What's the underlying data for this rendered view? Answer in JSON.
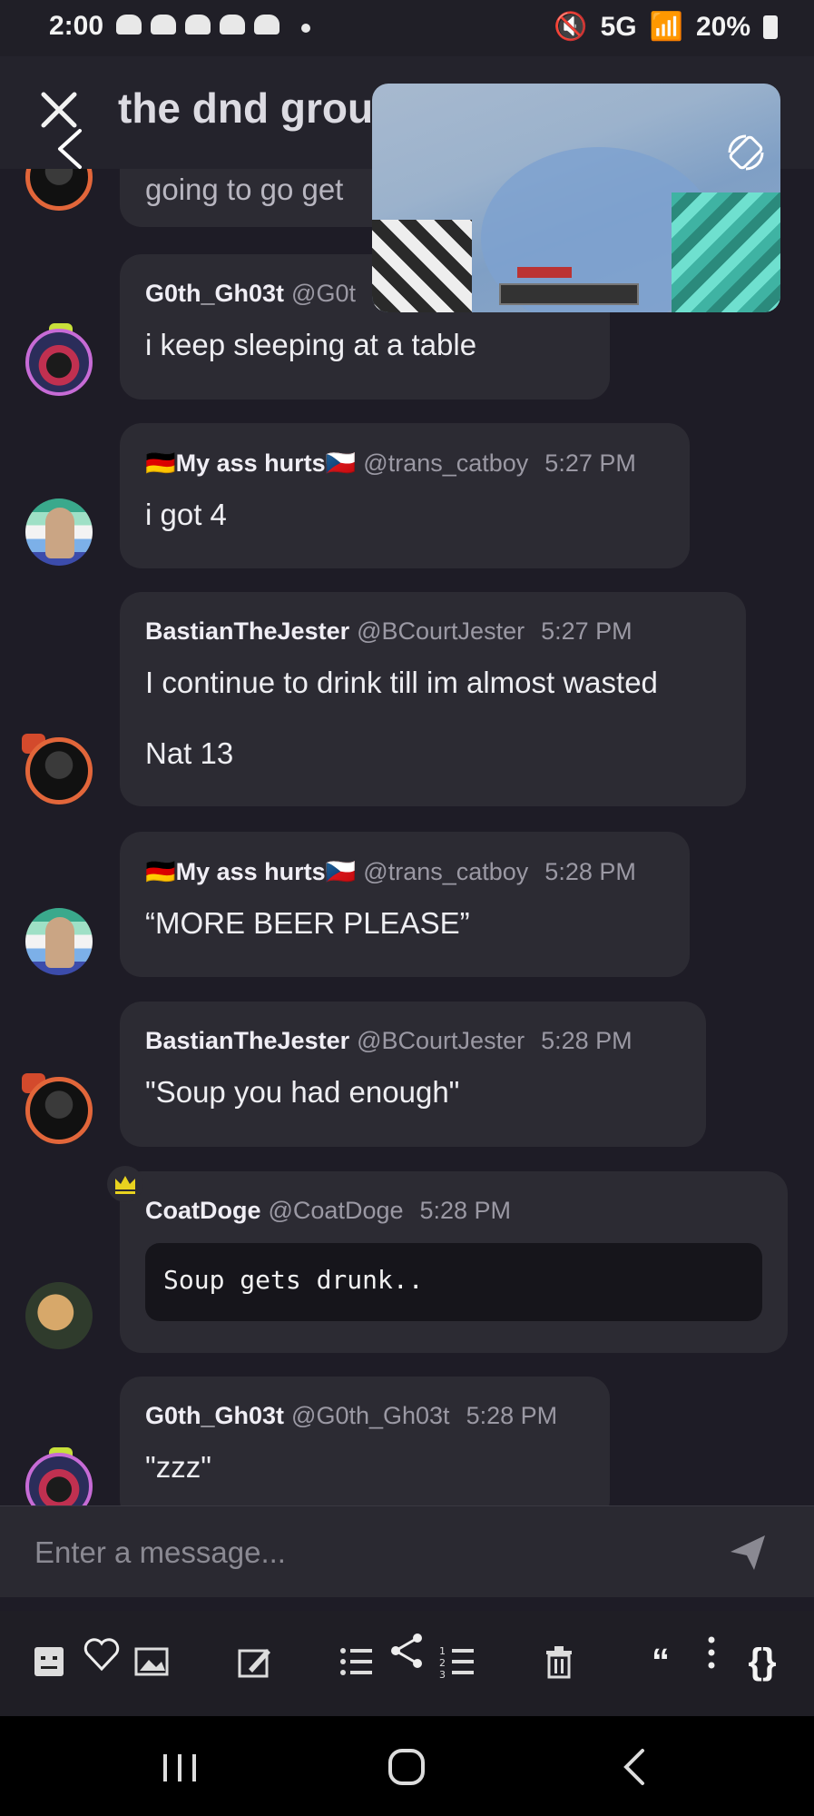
{
  "status_bar": {
    "time": "2:00",
    "right_text": "5G",
    "battery": "20%"
  },
  "header": {
    "title": "the dnd group"
  },
  "composer": {
    "placeholder": "Enter a message..."
  },
  "messages": [
    {
      "name": "",
      "handle": "",
      "time": "",
      "lines": [
        "going to go get"
      ]
    },
    {
      "name": "G0th_Gh03t",
      "handle": "@G0t",
      "time": "",
      "lines": [
        "i keep sleeping at a table"
      ]
    },
    {
      "name": "🇩🇪My ass hurts🇨🇿",
      "handle": "@trans_catboy",
      "time": "5:27 PM",
      "lines": [
        "i got 4"
      ]
    },
    {
      "name": "BastianTheJester",
      "handle": "@BCourtJester",
      "time": "5:27 PM",
      "lines": [
        "I continue to drink till im almost wasted",
        "Nat 13"
      ]
    },
    {
      "name": "🇩🇪My ass hurts🇨🇿",
      "handle": "@trans_catboy",
      "time": "5:28 PM",
      "lines": [
        "“MORE BEER PLEASE”"
      ]
    },
    {
      "name": "BastianTheJester",
      "handle": "@BCourtJester",
      "time": "5:28 PM",
      "lines": [
        "\"Soup you had enough\""
      ]
    },
    {
      "name": "CoatDoge",
      "handle": "@CoatDoge",
      "time": "5:28 PM",
      "code": "Soup gets drunk.."
    },
    {
      "name": "G0th_Gh03t",
      "handle": "@G0th_Gh03t",
      "time": "5:28 PM",
      "lines": [
        "\"zzz\""
      ]
    }
  ],
  "icons": [
    "close-icon",
    "back-icon",
    "rotate-icon",
    "crown-icon",
    "send-icon",
    "sticker-icon",
    "heart-icon",
    "image-icon",
    "edit-icon",
    "bullet-list-icon",
    "share-icon",
    "numbered-list-icon",
    "trash-icon",
    "quote-icon",
    "more-icon",
    "code-braces-icon"
  ],
  "toolbar": {
    "quote": "“",
    "braces": "{}"
  },
  "colors": {
    "background": "#1e1c26",
    "bubble": "#2c2b33",
    "composer": "#2a2931"
  }
}
